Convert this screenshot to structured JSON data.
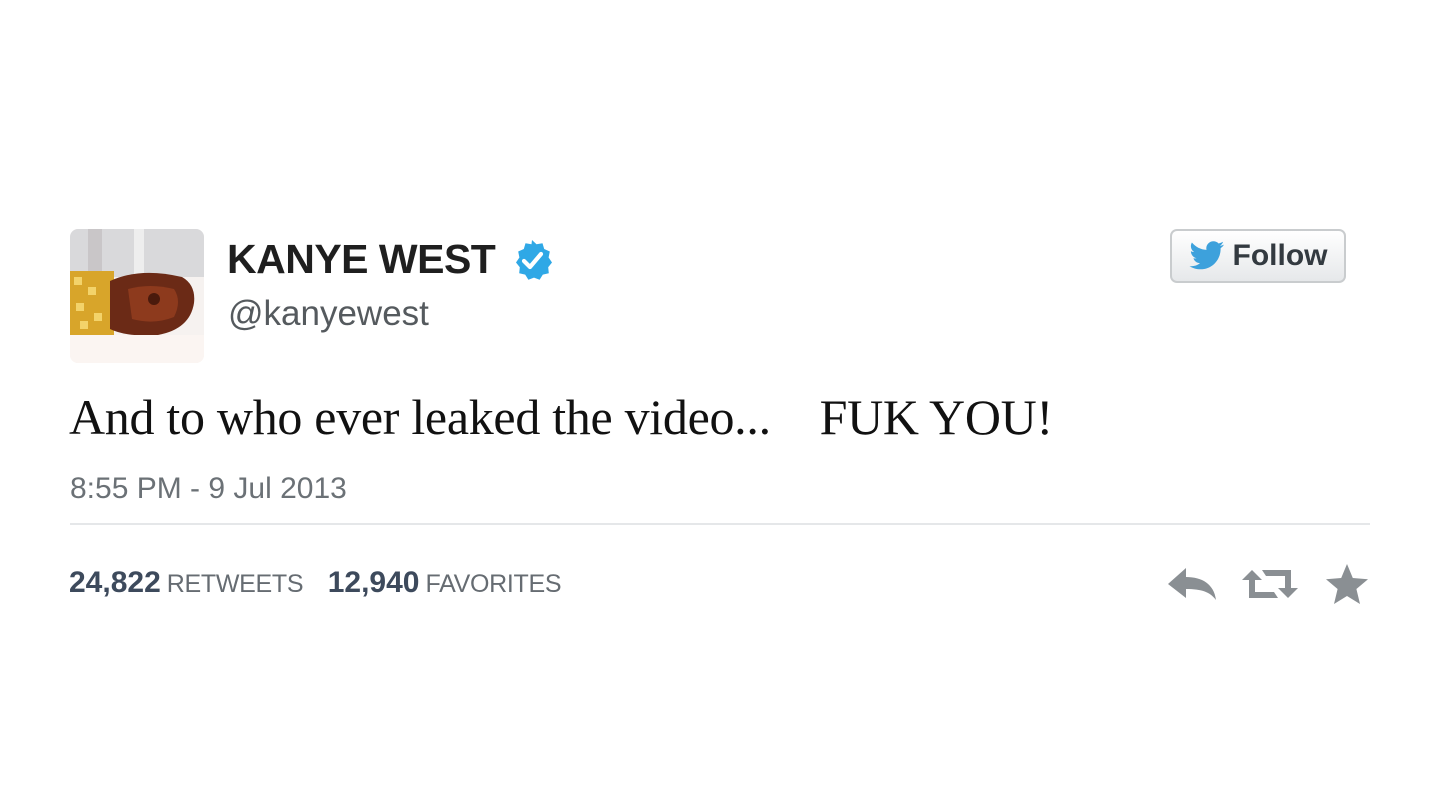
{
  "tweet": {
    "display_name": "KANYE WEST",
    "handle": "@kanyewest",
    "verified_icon": "verified-badge-icon",
    "text": "And to who ever leaked the video...    FUK YOU!",
    "timestamp": "8:55 PM - 9 Jul 2013",
    "follow_button": {
      "label": "Follow",
      "icon": "twitter-bird-icon"
    },
    "stats": {
      "retweets_count": "24,822",
      "retweets_label": "RETWEETS",
      "favorites_count": "12,940",
      "favorites_label": "FAVORITES"
    },
    "actions": {
      "reply_icon": "reply-icon",
      "retweet_icon": "retweet-icon",
      "favorite_icon": "star-icon"
    }
  },
  "colors": {
    "verified_blue": "#2fa8e6",
    "twitter_blue": "#3da1dc",
    "action_gray": "#8a8f93"
  }
}
